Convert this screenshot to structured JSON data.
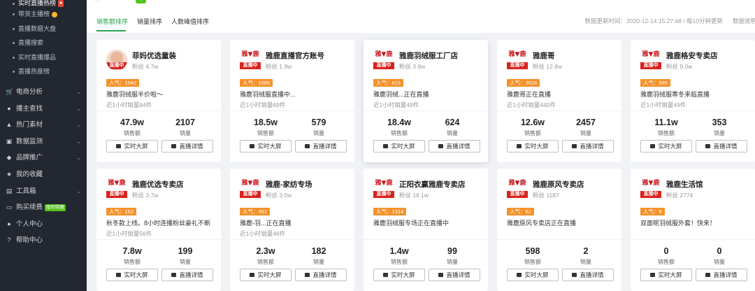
{
  "sidebar": {
    "sub_items": [
      {
        "label": "实时直播热榜"
      },
      {
        "label": "带货主播榜"
      },
      {
        "label": "直播数据大盘"
      },
      {
        "label": "直播搜索"
      },
      {
        "label": "实时直播爆品"
      },
      {
        "label": "直播热度榜"
      }
    ],
    "menu": [
      {
        "label": "电商分析",
        "icon": "cart-icon",
        "glyph": "🛒",
        "chev": true
      },
      {
        "label": "播主查找",
        "icon": "search-user-icon",
        "glyph": "●",
        "chev": true
      },
      {
        "label": "热门素材",
        "icon": "fire-icon",
        "glyph": "▲",
        "chev": true
      },
      {
        "label": "数据监测",
        "icon": "monitor-icon",
        "glyph": "▣",
        "chev": true
      },
      {
        "label": "品牌推广",
        "icon": "brand-icon",
        "glyph": "◆",
        "chev": true
      },
      {
        "label": "我的收藏",
        "icon": "star-icon",
        "glyph": "★",
        "chev": false
      },
      {
        "label": "工具箱",
        "icon": "toolbox-icon",
        "glyph": "▤",
        "chev": true
      },
      {
        "label": "购买续费",
        "icon": "card-icon",
        "glyph": "▭",
        "chev": false,
        "badge": "限时特惠"
      },
      {
        "label": "个人中心",
        "icon": "user-icon",
        "glyph": "●",
        "chev": false
      },
      {
        "label": "帮助中心",
        "icon": "help-icon",
        "glyph": "?",
        "chev": false
      }
    ]
  },
  "tabs": [
    {
      "label": "销售额排序"
    },
    {
      "label": "销量排序"
    },
    {
      "label": "人数峰值排序"
    }
  ],
  "update_text": "数据更新时间：2020-12-14 15:27:48 / 每10分钟更新",
  "data_explain": "数据说明",
  "logo_text": {
    "a": "雅",
    "b": "鹿",
    "live": "直播中"
  },
  "stat_labels": {
    "sales": "销售额",
    "volume": "销量"
  },
  "buttons": {
    "screen": "实时大屏",
    "detail": "直播详情"
  },
  "cards": [
    {
      "name": "菲妈优选童装",
      "fans": "粉丝 4.7w",
      "pop": "人气：1942",
      "title": "雅鹿羽绒服半价啦～",
      "sales_line": "近1小时销量84件",
      "sales": "47.9w",
      "volume": "2107"
    },
    {
      "name": "雅鹿直播官方账号",
      "fans": "粉丝 1.9w",
      "pop": "人气：1585",
      "title": "雅鹿羽绒服直播中...",
      "sales_line": "近1小时销量69件",
      "sales": "18.5w",
      "volume": "579"
    },
    {
      "name": "雅鹿羽绒服工厂店",
      "fans": "粉丝 3.9w",
      "pop": "人气：615",
      "title": "雅鹿羽绒...正在直播",
      "sales_line": "近1小时销量49件",
      "sales": "18.4w",
      "volume": "624"
    },
    {
      "name": "雅鹿哥",
      "fans": "粉丝 12.8w",
      "pop": "人气：3026",
      "title": "雅鹿哥正在直播",
      "sales_line": "近1小时销量440件",
      "sales": "12.6w",
      "volume": "2457"
    },
    {
      "name": "雅鹿格安专卖店",
      "fans": "粉丝 9.0w",
      "pop": "人气：595",
      "title": "雅鹿羽绒服寒冬来临直播",
      "sales_line": "近1小时销量49件",
      "sales": "11.1w",
      "volume": "353"
    },
    {
      "name": "雅鹿优选专卖店",
      "fans": "粉丝 3.7w",
      "pop": "人气：162",
      "title": "秋冬款上线。8小时连播粉丝豪礼不断",
      "sales_line": "近1小时销量56件",
      "sales": "7.8w",
      "volume": "199"
    },
    {
      "name": "雅鹿-家纺专场",
      "fans": "粉丝 3.5w",
      "pop": "人气：451",
      "title": "雅鹿-羽...正在直播",
      "sales_line": "近1小时销量46件",
      "sales": "2.3w",
      "volume": "182"
    },
    {
      "name": "正阳衣赢雅鹿专卖店",
      "fans": "粉丝 18.1w",
      "pop": "人气：1314",
      "title": "雅鹿羽绒服专场正在直播中",
      "sales_line": "",
      "sales": "1.4w",
      "volume": "99"
    },
    {
      "name": "雅鹿原风专卖店",
      "fans": "粉丝 1187",
      "pop": "人气：61",
      "title": "雅鹿原风专卖店正在直播",
      "sales_line": "",
      "sales": "598",
      "volume": "2"
    },
    {
      "name": "雅鹿生活馆",
      "fans": "粉丝 2774",
      "pop": "人气：6",
      "title": "双面呢羽绒服外套！快来！",
      "sales_line": "",
      "sales": "0",
      "volume": "0"
    }
  ]
}
